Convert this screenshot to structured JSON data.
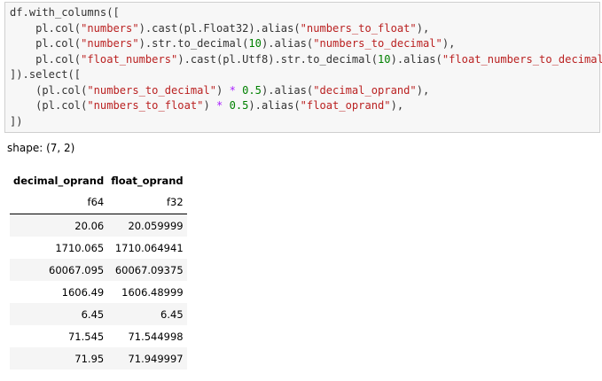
{
  "code_cell": {
    "lines": [
      [
        {
          "t": "df.with_columns([",
          "k": ""
        }
      ],
      [
        {
          "t": "    pl.col(",
          "k": ""
        },
        {
          "t": "\"numbers\"",
          "k": "str"
        },
        {
          "t": ").cast(pl.Float32).alias(",
          "k": ""
        },
        {
          "t": "\"numbers_to_float\"",
          "k": "str"
        },
        {
          "t": "),",
          "k": ""
        }
      ],
      [
        {
          "t": "    pl.col(",
          "k": ""
        },
        {
          "t": "\"numbers\"",
          "k": "str"
        },
        {
          "t": ").str.to_decimal(",
          "k": ""
        },
        {
          "t": "10",
          "k": "num"
        },
        {
          "t": ").alias(",
          "k": ""
        },
        {
          "t": "\"numbers_to_decimal\"",
          "k": "str"
        },
        {
          "t": "),",
          "k": ""
        }
      ],
      [
        {
          "t": "    pl.col(",
          "k": ""
        },
        {
          "t": "\"float_numbers\"",
          "k": "str"
        },
        {
          "t": ").cast(pl.Utf8).str.to_decimal(",
          "k": ""
        },
        {
          "t": "10",
          "k": "num"
        },
        {
          "t": ").alias(",
          "k": ""
        },
        {
          "t": "\"float_numbers_to_decimal\"",
          "k": "str"
        },
        {
          "t": "),",
          "k": ""
        }
      ],
      [
        {
          "t": "]).select([",
          "k": ""
        }
      ],
      [
        {
          "t": "    (pl.col(",
          "k": ""
        },
        {
          "t": "\"numbers_to_decimal\"",
          "k": "str"
        },
        {
          "t": ") ",
          "k": ""
        },
        {
          "t": "*",
          "k": "op"
        },
        {
          "t": " ",
          "k": ""
        },
        {
          "t": "0.5",
          "k": "num"
        },
        {
          "t": ").alias(",
          "k": ""
        },
        {
          "t": "\"decimal_oprand\"",
          "k": "str"
        },
        {
          "t": "),",
          "k": ""
        }
      ],
      [
        {
          "t": "    (pl.col(",
          "k": ""
        },
        {
          "t": "\"numbers_to_float\"",
          "k": "str"
        },
        {
          "t": ") ",
          "k": ""
        },
        {
          "t": "*",
          "k": "op"
        },
        {
          "t": " ",
          "k": ""
        },
        {
          "t": "0.5",
          "k": "num"
        },
        {
          "t": ").alias(",
          "k": ""
        },
        {
          "t": "\"float_oprand\"",
          "k": "str"
        },
        {
          "t": "),",
          "k": ""
        }
      ],
      [
        {
          "t": "])",
          "k": ""
        }
      ]
    ]
  },
  "output": {
    "shape_text": "shape: (7, 2)",
    "columns": [
      "decimal_oprand",
      "float_oprand"
    ],
    "dtypes": [
      "f64",
      "f32"
    ],
    "rows": [
      [
        "20.06",
        "20.059999"
      ],
      [
        "1710.065",
        "1710.064941"
      ],
      [
        "60067.095",
        "60067.09375"
      ],
      [
        "1606.49",
        "1606.48999"
      ],
      [
        "6.45",
        "6.45"
      ],
      [
        "71.545",
        "71.544998"
      ],
      [
        "71.95",
        "71.949997"
      ]
    ]
  }
}
